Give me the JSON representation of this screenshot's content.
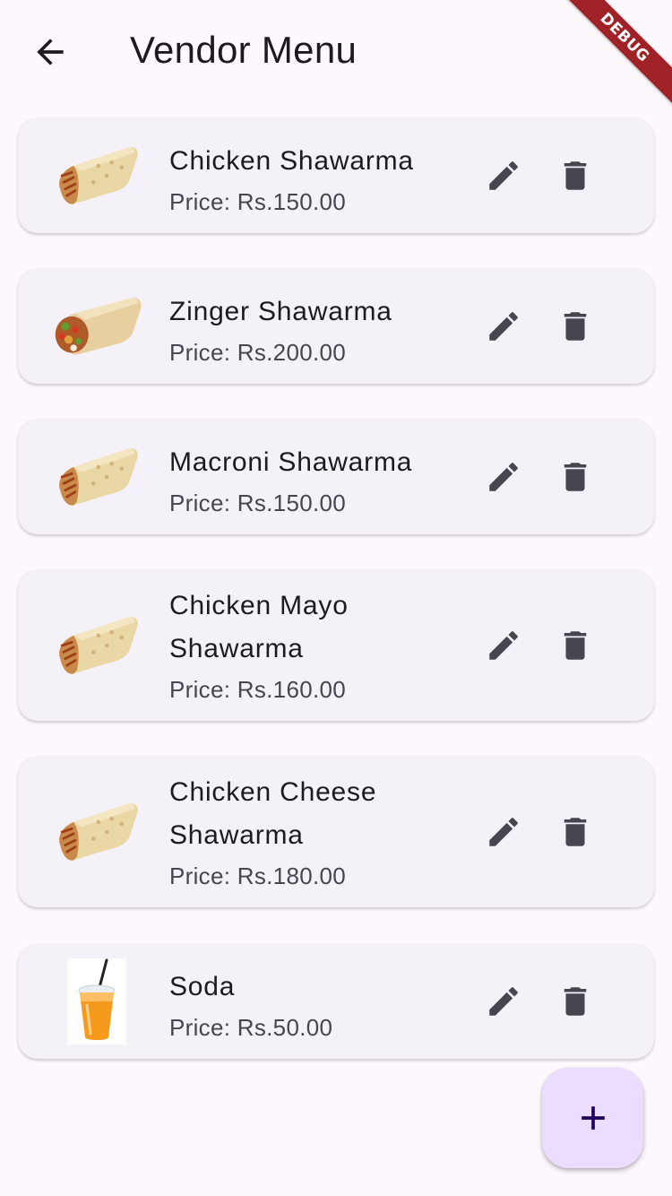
{
  "app_bar": {
    "title": "Vendor Menu",
    "back_icon": "arrow-back-icon"
  },
  "debug_banner": {
    "label": "DEBUG",
    "color": "#a12226"
  },
  "menu_items": [
    {
      "name": "Chicken Shawarma",
      "price": "Price: Rs.150.00",
      "image": "shawarma-wrap"
    },
    {
      "name": "Zinger Shawarma",
      "price": "Price: Rs.200.00",
      "image": "zinger-wrap"
    },
    {
      "name": "Macroni Shawarma",
      "price": "Price: Rs.150.00",
      "image": "shawarma-wrap"
    },
    {
      "name": "Chicken Mayo Shawarma",
      "price": "Price: Rs.160.00",
      "image": "shawarma-wrap"
    },
    {
      "name": "Chicken Cheese Shawarma",
      "price": "Price: Rs.180.00",
      "image": "shawarma-wrap"
    },
    {
      "name": "Soda",
      "price": "Price: Rs.50.00",
      "image": "soda-cup"
    }
  ],
  "actions": {
    "edit_icon": "pencil-icon",
    "delete_icon": "trash-icon"
  },
  "fab": {
    "icon": "plus-icon",
    "color": "#eaddff"
  },
  "colors": {
    "background": "#fdf8fd",
    "card": "#f4f1f8",
    "icon": "#49454f",
    "fab_icon": "#21005d"
  }
}
